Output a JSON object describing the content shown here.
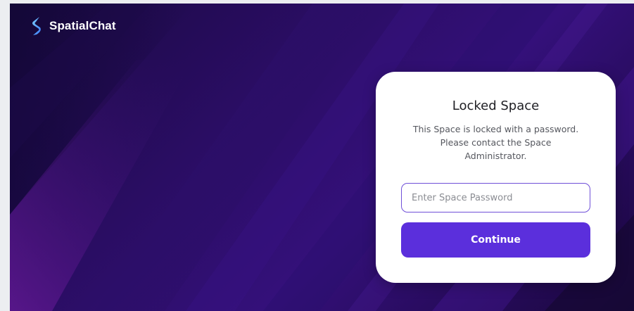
{
  "brand": {
    "name": "SpatialChat",
    "logo_icon": "spatialchat-logo-icon"
  },
  "lock_card": {
    "title": "Locked Space",
    "description_lines": [
      "This Space is locked with a password.",
      "Please contact the Space",
      "Administrator."
    ],
    "password_input": {
      "placeholder": "Enter Space Password",
      "value": ""
    },
    "continue_label": "Continue"
  },
  "colors": {
    "accent": "#5b2fdc",
    "background": "#2a0d63",
    "card": "#ffffff"
  }
}
